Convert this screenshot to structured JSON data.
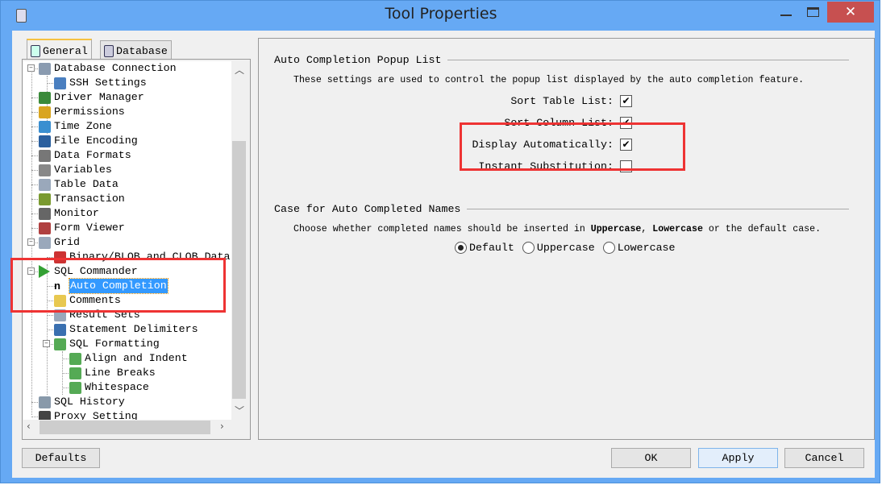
{
  "window": {
    "title": "Tool Properties",
    "close_glyph": "✕"
  },
  "tabs": [
    {
      "label": "General",
      "active": true
    },
    {
      "label": "Database",
      "active": false
    }
  ],
  "tree": [
    {
      "label": "Database Connection",
      "level": 0,
      "expanded": true,
      "icon": "database-icon",
      "color": "#8a9bb0"
    },
    {
      "label": "SSH Settings",
      "level": 1,
      "icon": "ssh-server-icon",
      "color": "#4a7fc0"
    },
    {
      "label": "Driver Manager",
      "level": 0,
      "icon": "driver-card-icon",
      "color": "#3a8a3a"
    },
    {
      "label": "Permissions",
      "level": 0,
      "icon": "key-icon",
      "color": "#d9a520"
    },
    {
      "label": "Time Zone",
      "level": 0,
      "icon": "globe-clock-icon",
      "color": "#3a8fd0"
    },
    {
      "label": "File Encoding",
      "level": 0,
      "icon": "floppy-disk-icon",
      "color": "#2a5f9e"
    },
    {
      "label": "Data Formats",
      "level": 0,
      "icon": "percent-icon",
      "color": "#777777"
    },
    {
      "label": "Variables",
      "level": 0,
      "icon": "dollar-icon",
      "color": "#888888"
    },
    {
      "label": "Table Data",
      "level": 0,
      "icon": "table-icon",
      "color": "#9aa8bb"
    },
    {
      "label": "Transaction",
      "level": 0,
      "icon": "transaction-icon",
      "color": "#7a9a30"
    },
    {
      "label": "Monitor",
      "level": 0,
      "icon": "stopwatch-icon",
      "color": "#666666"
    },
    {
      "label": "Form Viewer",
      "level": 0,
      "icon": "form-icon",
      "color": "#b04040"
    },
    {
      "label": "Grid",
      "level": 0,
      "expanded": true,
      "icon": "grid-icon",
      "color": "#9aa8bb"
    },
    {
      "label": "Binary/BLOB and CLOB Data",
      "level": 1,
      "icon": "puzzle-icon",
      "color": "#cc3333"
    },
    {
      "label": "SQL Commander",
      "level": 0,
      "expanded": true,
      "icon": "play-icon",
      "color": "#33a033"
    },
    {
      "label": "Auto Completion",
      "level": 1,
      "selected": true,
      "icon": "n-letter-icon",
      "color": "#222222"
    },
    {
      "label": "Comments",
      "level": 1,
      "icon": "note-icon",
      "color": "#e8c850"
    },
    {
      "label": "Result Sets",
      "level": 1,
      "icon": "table-icon",
      "color": "#9aa8bb"
    },
    {
      "label": "Statement Delimiters",
      "level": 1,
      "icon": "delimiter-icon",
      "color": "#3a70b0"
    },
    {
      "label": "SQL Formatting",
      "level": 1,
      "expanded": true,
      "icon": "format-icon",
      "color": "#55aa55"
    },
    {
      "label": "Align and Indent",
      "level": 2,
      "icon": "format-icon",
      "color": "#55aa55"
    },
    {
      "label": "Line Breaks",
      "level": 2,
      "icon": "format-icon",
      "color": "#55aa55"
    },
    {
      "label": "Whitespace",
      "level": 2,
      "icon": "format-icon",
      "color": "#55aa55"
    },
    {
      "label": "SQL History",
      "level": 0,
      "icon": "history-icon",
      "color": "#8899aa"
    },
    {
      "label": "Proxy Setting",
      "level": 0,
      "icon": "proxy-agent-icon",
      "color": "#444444"
    }
  ],
  "popup": {
    "title": "Auto Completion Popup List",
    "description": "These settings are used to control the popup list displayed by the auto completion feature.",
    "options": [
      {
        "label": "Sort Table List:",
        "checked": true
      },
      {
        "label": "Sort Column List:",
        "checked": true
      },
      {
        "label": "Display Automatically:",
        "checked": true
      },
      {
        "label": "Instant Substitution:",
        "checked": false
      }
    ]
  },
  "case": {
    "title": "Case for Auto Completed Names",
    "desc_pre": "Choose whether completed names should be inserted in ",
    "desc_upper": "Uppercase",
    "desc_sep": ", ",
    "desc_lower": "Lowercase",
    "desc_post": " or the default case.",
    "options": [
      {
        "label": "Default",
        "selected": true
      },
      {
        "label": "Uppercase",
        "selected": false
      },
      {
        "label": "Lowercase",
        "selected": false
      }
    ]
  },
  "buttons": {
    "defaults": "Defaults",
    "ok": "OK",
    "apply": "Apply",
    "cancel": "Cancel"
  },
  "annotation_color": "#ee3333"
}
